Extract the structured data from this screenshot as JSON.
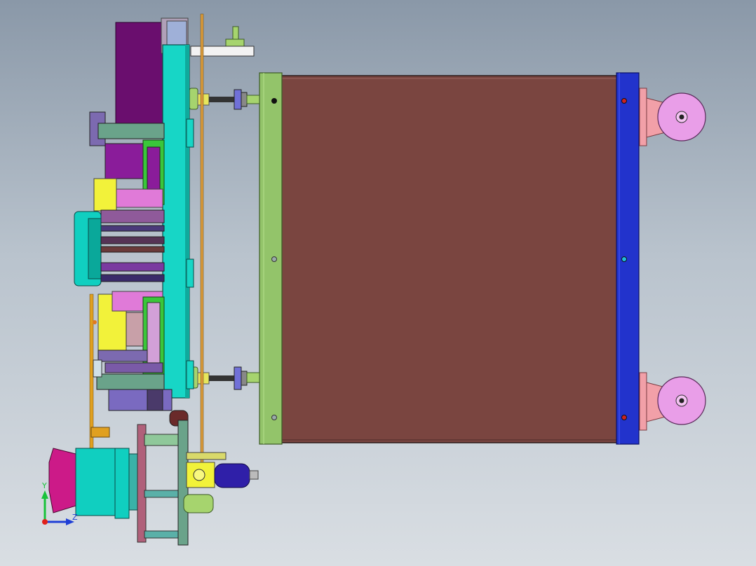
{
  "viewport": {
    "background_top": "#8a98a8",
    "background_bottom": "#d9dee3"
  },
  "model": {
    "panel_color": "#7a4540",
    "left_rail_color": "#93c46a",
    "right_rail_color": "#2233cc",
    "caster_color": "#e99ee8",
    "caster_bracket_color": "#f2a0a8",
    "mounting_plate_color": "#17d6c6",
    "motor_color": "#6a0e6e",
    "spindle_color": "#10cfc0",
    "nozzle_color": "#cc1a88"
  },
  "triad": {
    "y_label": "Y",
    "z_label": "Z",
    "y_color": "#18c23a",
    "z_color": "#1f3fd6",
    "x_color": "#e0201a"
  }
}
